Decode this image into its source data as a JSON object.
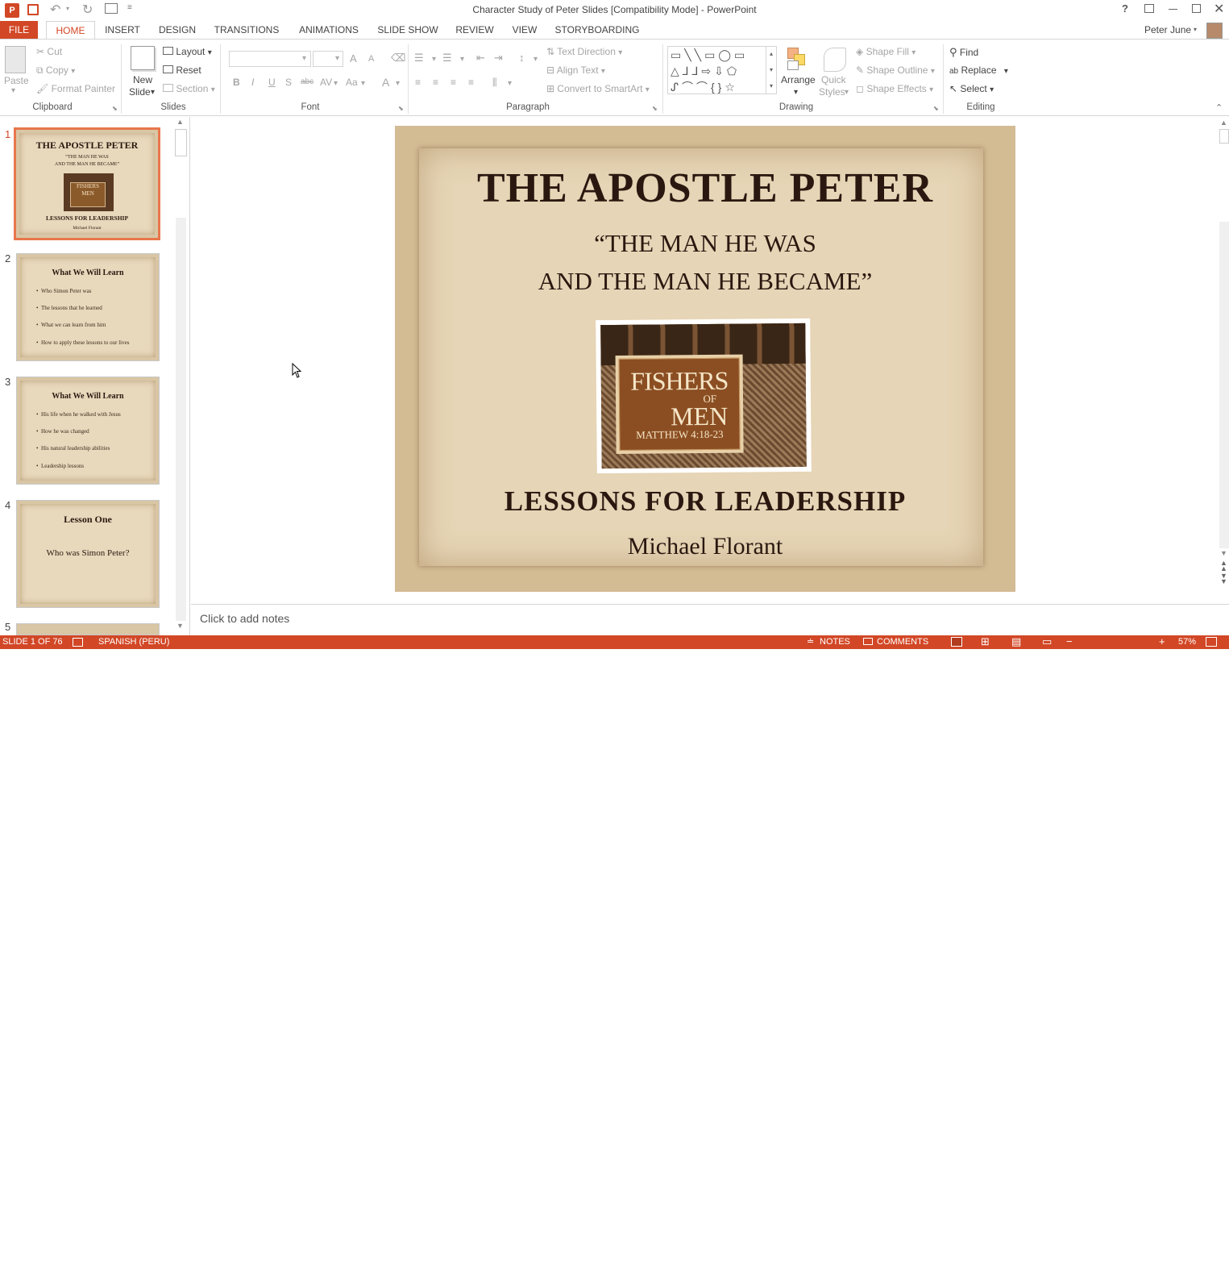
{
  "window": {
    "title": "Character Study of Peter Slides [Compatibility Mode] - PowerPoint",
    "user": "Peter June",
    "help": "?",
    "controls": [
      "restore-ribbon",
      "minimize",
      "maximize",
      "close"
    ]
  },
  "tabs": [
    "FILE",
    "HOME",
    "INSERT",
    "DESIGN",
    "TRANSITIONS",
    "ANIMATIONS",
    "SLIDE SHOW",
    "REVIEW",
    "VIEW",
    "STORYBOARDING"
  ],
  "active_tab": "HOME",
  "ribbon": {
    "clipboard": {
      "paste": "Paste",
      "cut": "Cut",
      "copy": "Copy",
      "format_painter": "Format Painter",
      "label": "Clipboard"
    },
    "slides": {
      "new_slide_1": "New",
      "new_slide_2": "Slide",
      "layout": "Layout",
      "reset": "Reset",
      "section": "Section",
      "label": "Slides"
    },
    "font": {
      "label": "Font",
      "bold": "B",
      "italic": "I",
      "underline": "U",
      "strike": "abc",
      "spacing": "AV",
      "case": "Aa",
      "color": "A",
      "grow": "A",
      "shrink": "A"
    },
    "paragraph": {
      "text_direction": "Text Direction",
      "align_text": "Align Text",
      "convert_smartart": "Convert to SmartArt",
      "label": "Paragraph"
    },
    "drawing": {
      "arrange": "Arrange",
      "quick_styles_1": "Quick",
      "quick_styles_2": "Styles",
      "shape_fill": "Shape Fill",
      "shape_outline": "Shape Outline",
      "shape_effects": "Shape Effects",
      "label": "Drawing"
    },
    "editing": {
      "find": "Find",
      "replace": "Replace",
      "select": "Select",
      "label": "Editing"
    }
  },
  "thumbnails": [
    {
      "num": "1",
      "title": "THE APOSTLE PETER",
      "sub1": "“THE MAN HE WAS",
      "sub2": "AND THE MAN HE BECAME”",
      "logo1": "FISHERS",
      "logo2": "MEN",
      "bottom": "LESSONS FOR LEADERSHIP",
      "author": "Michael Florant"
    },
    {
      "num": "2",
      "title": "What We Will Learn",
      "bullets": [
        "Who Simon Peter was",
        "The lessons that he learned",
        "What we can learn from him",
        "How to apply these lessons to our lives"
      ]
    },
    {
      "num": "3",
      "title": "What We Will Learn",
      "bullets": [
        "His life when he walked with Jesus",
        "How he was changed",
        "His natural leadership abilities",
        "Leadership lessons"
      ]
    },
    {
      "num": "4",
      "title": "Lesson One",
      "body": "Who was Simon Peter?"
    },
    {
      "num": "5"
    }
  ],
  "slide": {
    "title": "THE APOSTLE PETER",
    "subtitle_line1": "“THE MAN HE WAS",
    "subtitle_line2": "AND THE MAN HE BECAME”",
    "logo_line1": "FISHERS",
    "logo_line2": "OF",
    "logo_line3": "MEN",
    "logo_ref": "MATTHEW 4:18-23",
    "bottom_title": "LESSONS FOR LEADERSHIP",
    "author": "Michael Florant"
  },
  "notes": {
    "placeholder": "Click to add notes"
  },
  "status": {
    "slide_count": "SLIDE 1 OF 76",
    "language": "SPANISH (PERU)",
    "notes": "NOTES",
    "comments": "COMMENTS",
    "zoom": "57%",
    "zoom_fraction": 0.57
  },
  "colors": {
    "accent": "#d24726",
    "slide_bg": "#e6d5b6",
    "text_dark": "#2a1810"
  }
}
